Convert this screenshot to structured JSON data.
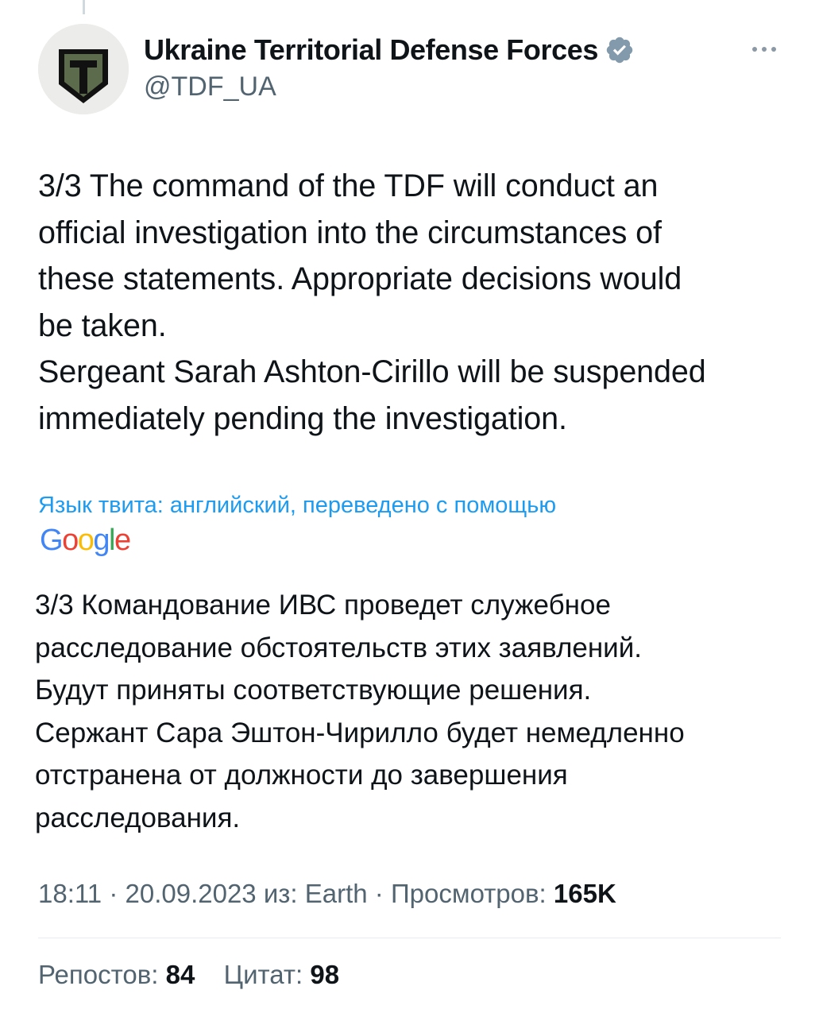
{
  "author": {
    "display_name": "Ukraine Territorial Defense Forces",
    "handle": "@TDF_UA",
    "avatar_icon": "tdf-shield-logo-icon",
    "verified_icon": "verified-badge-icon",
    "verified_color": "#1d9bf0"
  },
  "more_icon": "more-options-icon",
  "tweet": {
    "text": "3/3 The command of the TDF will conduct an\nofficial investigation into the circumstances of\nthese statements. Appropriate decisions would\nbe taken.\nSergeant Sarah Ashton-Cirillo will be suspended\nimmediately pending the investigation."
  },
  "translation": {
    "note": "Язык твита: английский, переведено с помощью",
    "provider": "Google",
    "text": "3/3 Командование ИВС проведет служебное\nрасследование обстоятельств этих заявлений.\nБудут приняты соответствующие решения.\nСержант Сара Эштон-Чирилло будет немедленно\nотстранена от должности до завершения\nрасследования.",
    "link_color": "#1d9bf0"
  },
  "meta": {
    "time": "18:11",
    "separator": "·",
    "date": "20.09.2023",
    "source_prefix": "из:",
    "source": "Earth",
    "views_label": "Просмотров:",
    "views_value": "165K"
  },
  "stats": {
    "reposts_label": "Репостов:",
    "reposts_value": "84",
    "quotes_label": "Цитат:",
    "quotes_value": "98"
  }
}
